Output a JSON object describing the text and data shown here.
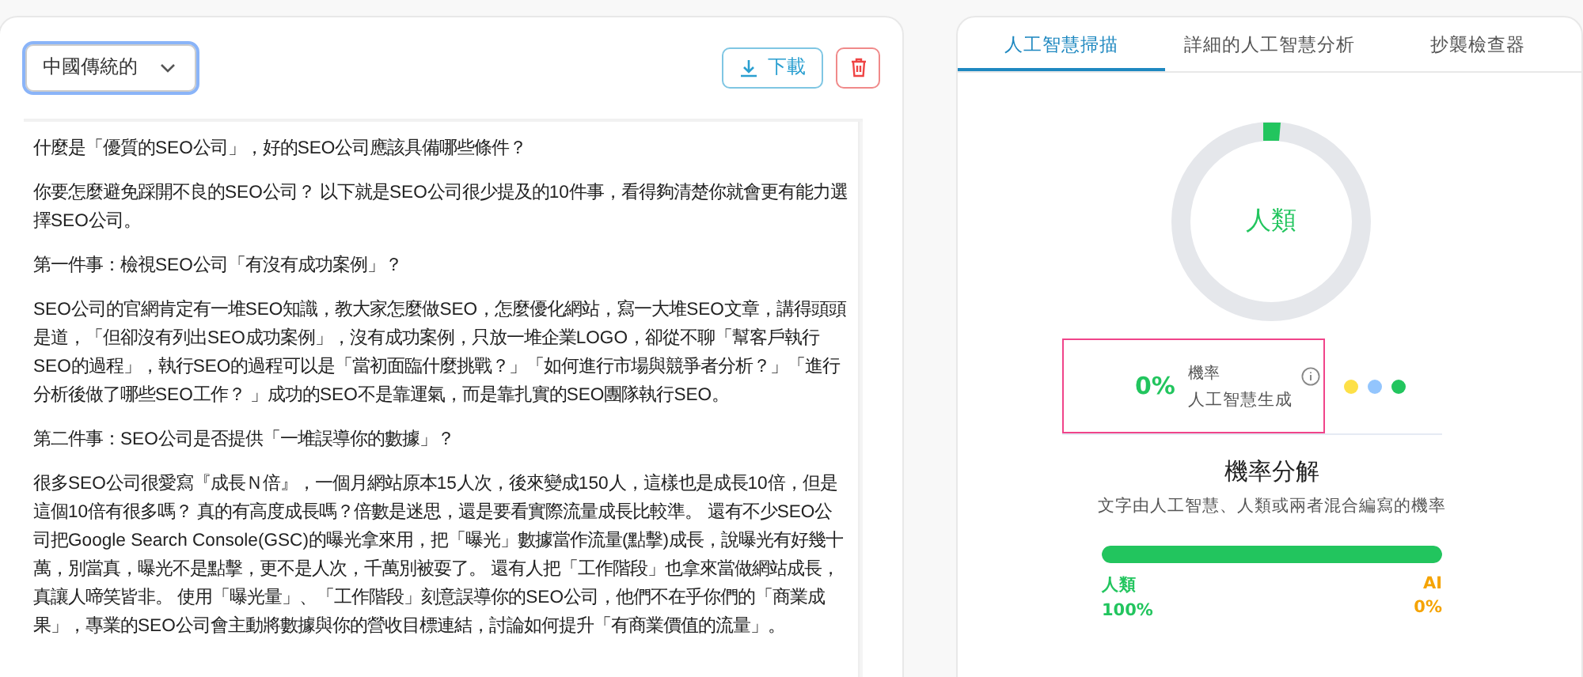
{
  "editor": {
    "language_select": {
      "value": "中國傳統的"
    },
    "download_button": {
      "label": "下載"
    },
    "paragraphs": [
      "什麼是「優質的SEO公司」，好的SEO公司應該具備哪些條件？",
      "你要怎麼避免踩開不良的SEO公司？ 以下就是SEO公司很少提及的10件事，看得夠清楚你就會更有能力選擇SEO公司。",
      "第一件事：檢視SEO公司「有沒有成功案例」？",
      "SEO公司的官網肯定有一堆SEO知識，教大家怎麼做SEO，怎麼優化網站，寫一大堆SEO文章，講得頭頭是道，「但卻沒有列出SEO成功案例」，沒有成功案例，只放一堆企業LOGO，卻從不聊「幫客戶執行SEO的過程」，執行SEO的過程可以是「當初面臨什麼挑戰？」「如何進行市場與競爭者分析？」「進行分析後做了哪些SEO工作？ 」成功的SEO不是靠運氣，而是靠扎實的SEO團隊執行SEO。",
      "第二件事：SEO公司是否提供「一堆誤導你的數據」？",
      "很多SEO公司很愛寫『成長Ｎ倍』，一個月網站原本15人次，後來變成150人，這樣也是成長10倍，但是這個10倍有很多嗎？ 真的有高度成長嗎？倍數是迷思，還是要看實際流量成長比較準。 還有不少SEO公司把Google Search Console(GSC)的曝光拿來用，把「曝光」數據當作流量(點擊)成長，說曝光有好幾十萬，別當真，曝光不是點擊，更不是人次，千萬別被耍了。 還有人把「工作階段」也拿來當做網站成長，真讓人啼笑皆非。 使用「曝光量」、「工作階段」刻意誤導你的SEO公司，他們不在乎你們的「商業成果」，專業的SEO公司會主動將數據與你的營收目標連結，討論如何提升「有商業價值的流量」。"
    ]
  },
  "results": {
    "tabs": [
      {
        "label": "人工智慧掃描",
        "selected": true
      },
      {
        "label": "詳細的人工智慧分析",
        "selected": false
      },
      {
        "label": "抄襲檢查器",
        "selected": false
      }
    ],
    "verdict": "人類",
    "probability": {
      "value": "0%",
      "caption": "機率",
      "label": "人工智慧生成"
    },
    "legend_dots": [
      {
        "color": "#fde047"
      },
      {
        "color": "#93c5fd"
      },
      {
        "color": "#22c55e"
      }
    ],
    "breakdown": {
      "title": "機率分解",
      "subtitle": "文字由人工智慧、人類或兩者混合編寫的機率",
      "level": 1,
      "human": {
        "label": "人類",
        "value": "100%"
      },
      "ai": {
        "label": "AI",
        "value": "0%"
      }
    }
  }
}
